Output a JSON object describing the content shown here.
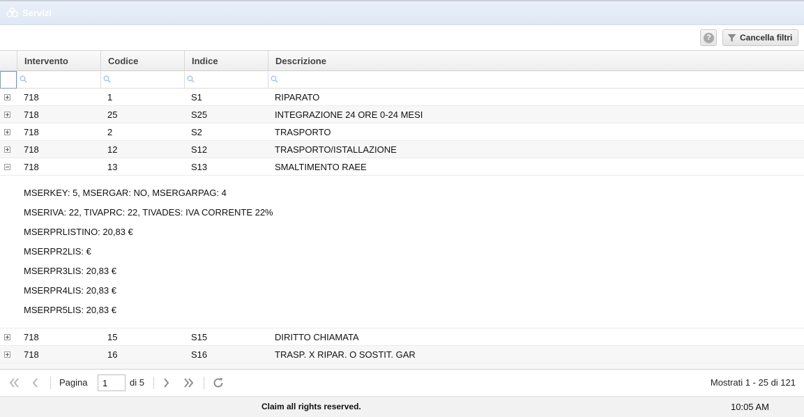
{
  "window": {
    "title": "Servizi"
  },
  "toolbar": {
    "help_label": "?",
    "clear_filters_label": "Cancella filtri"
  },
  "columns": [
    "Intervento",
    "Codice",
    "Indice",
    "Descrizione"
  ],
  "rows": [
    {
      "intervento": "718",
      "codice": "1",
      "indice": "S1",
      "descrizione": "RIPARATO",
      "expanded": false
    },
    {
      "intervento": "718",
      "codice": "25",
      "indice": "S25",
      "descrizione": "INTEGRAZIONE 24 ORE 0-24 MESI",
      "expanded": false
    },
    {
      "intervento": "718",
      "codice": "2",
      "indice": "S2",
      "descrizione": "TRASPORTO",
      "expanded": false
    },
    {
      "intervento": "718",
      "codice": "12",
      "indice": "S12",
      "descrizione": "TRASPORTO/ISTALLAZIONE",
      "expanded": false
    },
    {
      "intervento": "718",
      "codice": "13",
      "indice": "S13",
      "descrizione": "SMALTIMENTO RAEE",
      "expanded": true
    }
  ],
  "detail": [
    "MSERKEY: 5, MSERGAR: NO, MSERGARPAG: 4",
    "MSERIVA: 22, TIVAPRC: 22, TIVADES: IVA CORRENTE 22%",
    "MSERPRLISTINO: 20,83 €",
    "MSERPR2LIS: €",
    "MSERPR3LIS: 20,83 €",
    "MSERPR4LIS: 20,83 €",
    "MSERPR5LIS: 20,83 €"
  ],
  "rows_after": [
    {
      "intervento": "718",
      "codice": "15",
      "indice": "S15",
      "descrizione": "DIRITTO CHIAMATA",
      "expanded": false
    },
    {
      "intervento": "718",
      "codice": "16",
      "indice": "S16",
      "descrizione": "TRASP. X RIPAR. O SOSTIT. GAR",
      "expanded": false
    }
  ],
  "pager": {
    "page_label": "Pagina",
    "page_value": "1",
    "of_label": "di 5",
    "info": "Mostrati 1 - 25 di 121"
  },
  "footer": {
    "text": "Claim all rights reserved.",
    "time": "10:05 AM"
  }
}
